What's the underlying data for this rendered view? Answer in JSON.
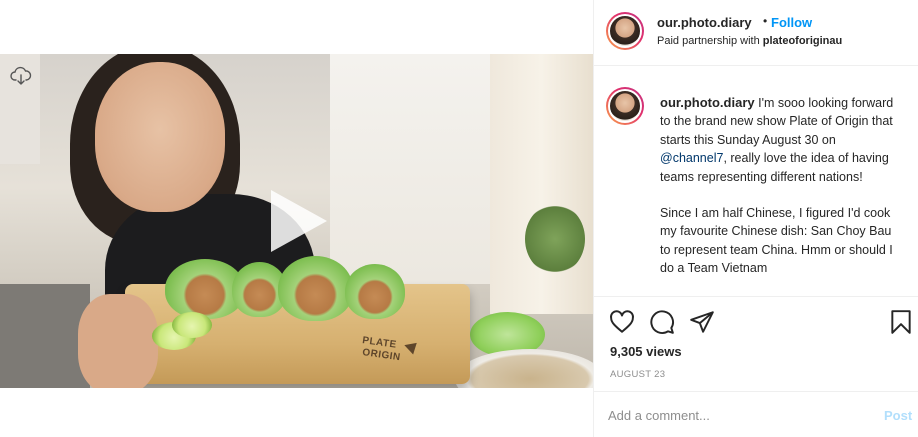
{
  "post": {
    "username": "our.photo.diary",
    "dot": "•",
    "follow_label": "Follow",
    "partnership_prefix": "Paid partnership with ",
    "partner": "plateoforiginau"
  },
  "caption": {
    "username": "our.photo.diary",
    "text_before_mention": " I'm sooo looking forward to the brand new show Plate of Origin that starts this Sunday August 30 on ",
    "mention": "@channel7",
    "text_after_mention": ", really love the idea of having teams representing different nations!",
    "paragraph2": "Since I am half Chinese, I figured I'd cook my favourite Chinese dish: San Choy Bau to represent team China. Hmm or should I do a Team Vietnam"
  },
  "media": {
    "board_logo": "PLATE\nORIGIN"
  },
  "stats": {
    "views": "9,305 views",
    "date": "AUGUST 23"
  },
  "comment": {
    "placeholder": "Add a comment...",
    "post_label": "Post"
  },
  "icons": {
    "play": "play-icon",
    "cloud": "cloud-download-icon",
    "like": "heart-icon",
    "comment": "comment-icon",
    "share": "paper-plane-icon",
    "save": "bookmark-icon"
  },
  "colors": {
    "follow": "#0095f6",
    "post_disabled": "#b2dffc",
    "mention": "#00376b",
    "muted": "#8e8e8e"
  }
}
